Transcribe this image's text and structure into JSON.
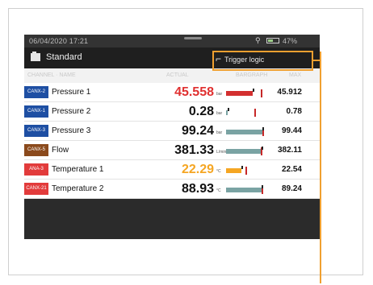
{
  "status": {
    "datetime": "06/04/2020  17:21",
    "battery": "47%",
    "battery_level": 0.47
  },
  "header": {
    "title": "Standard",
    "trigger_label": "Trigger logic"
  },
  "columns": {
    "channel": "CHANNEL · NAME",
    "actual": "ACTUAL",
    "bar": "BARGRAPH",
    "max": "MAX"
  },
  "rows": [
    {
      "tag": "CANX-2",
      "tag_color": "#1e4fa3",
      "name": "Pressure 1",
      "value": "45.558",
      "unit": "bar",
      "value_color": "#e03030",
      "max": "45.912",
      "fill": 0.72,
      "fill_color": "#d32f2f",
      "mark": 0.96
    },
    {
      "tag": "CANX-1",
      "tag_color": "#1e4fa3",
      "name": "Pressure 2",
      "value": "0.28",
      "unit": "bar",
      "value_color": "#111111",
      "max": "0.78",
      "fill": 0.04,
      "fill_color": "#7aa3a3",
      "mark": 0.78
    },
    {
      "tag": "CANX-3",
      "tag_color": "#1e4fa3",
      "name": "Pressure 3",
      "value": "99.24",
      "unit": "bar",
      "value_color": "#111111",
      "max": "99.44",
      "fill": 0.98,
      "fill_color": "#7aa3a3",
      "mark": 0.99
    },
    {
      "tag": "CANX-5",
      "tag_color": "#8b4a1c",
      "name": "Flow",
      "value": "381.33",
      "unit": "L/min",
      "value_color": "#111111",
      "max": "382.11",
      "fill": 0.95,
      "fill_color": "#7aa3a3",
      "mark": 0.96
    },
    {
      "tag": "ANA-3",
      "tag_color": "#e23b3b",
      "name": "Temperature 1",
      "value": "22.29",
      "unit": "°C",
      "value_color": "#f5a623",
      "max": "22.54",
      "fill": 0.42,
      "fill_color": "#f5a623",
      "mark": 0.55
    },
    {
      "tag": "CANX-21",
      "tag_color": "#e23b3b",
      "name": "Temperature 2",
      "value": "88.93",
      "unit": "°C",
      "value_color": "#111111",
      "max": "89.24",
      "fill": 0.96,
      "fill_color": "#7aa3a3",
      "mark": 0.97
    }
  ],
  "side": {
    "play": "play-icon",
    "icons": [
      "export-icon",
      "calculator-icon",
      "camera-icon",
      "more-icon"
    ],
    "more": "•••"
  },
  "accent": "#f0a030"
}
